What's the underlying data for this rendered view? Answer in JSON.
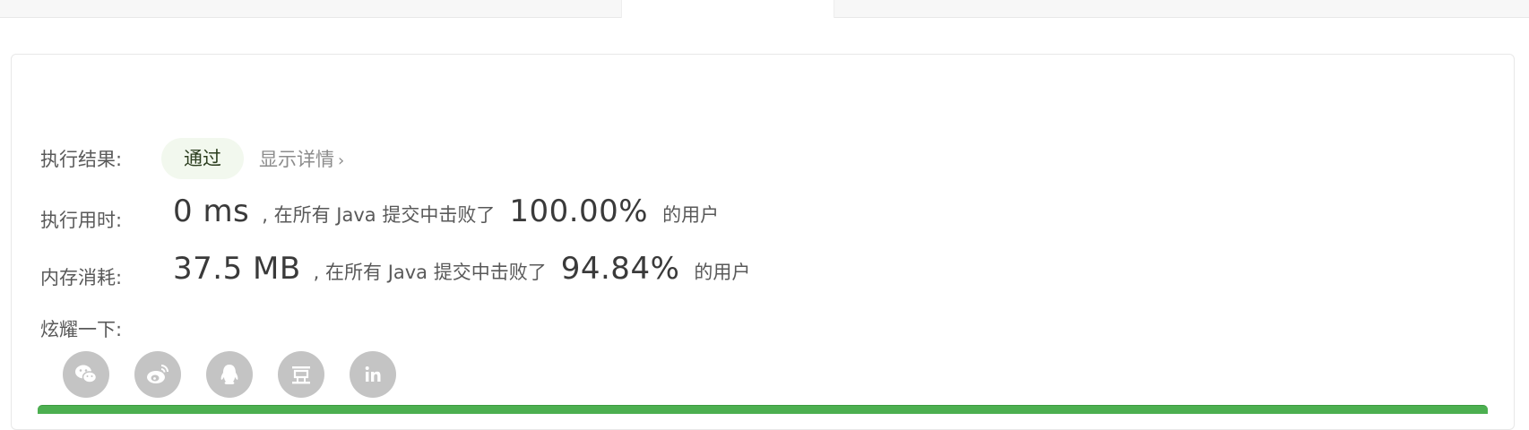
{
  "result": {
    "label": "执行结果:",
    "status": "通过",
    "details_link": "显示详情",
    "status_bg_color": "#f2f8ee"
  },
  "runtime": {
    "label": "执行用时:",
    "value": "0 ms",
    "middle_text": ", 在所有 Java 提交中击败了",
    "percent": "100.00%",
    "suffix": "的用户"
  },
  "memory": {
    "label": "内存消耗:",
    "value": "37.5 MB",
    "middle_text": ", 在所有 Java 提交中击败了",
    "percent": "94.84%",
    "suffix": "的用户"
  },
  "share": {
    "label": "炫耀一下:",
    "icons": [
      "wechat-icon",
      "weibo-icon",
      "qq-icon",
      "douban-icon",
      "linkedin-icon"
    ]
  },
  "colors": {
    "accent_green": "#4caf50",
    "icon_gray": "#c4c4c4"
  }
}
